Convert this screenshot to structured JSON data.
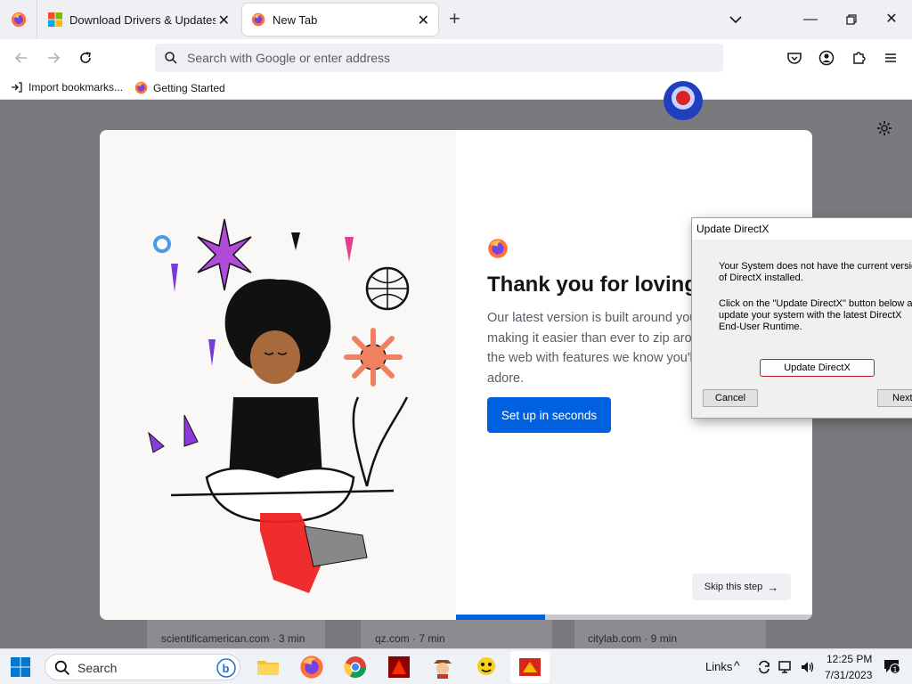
{
  "browser": {
    "tabs": [
      {
        "title": "Download Drivers & Updates for",
        "active": false
      },
      {
        "title": "New Tab",
        "active": true
      }
    ],
    "url_placeholder": "Search with Google or enter address",
    "bookmarks": [
      {
        "label": "Import bookmarks..."
      },
      {
        "label": "Getting Started"
      }
    ]
  },
  "onboarding": {
    "heading": "Thank you for loving Firefox",
    "body": "Our latest version is built around you, making it easier than ever to zip around the web with features we know you'll adore.",
    "primary_button": "Set up in seconds",
    "skip_button": "Skip this step",
    "progress": 0.25
  },
  "top_sites": [
    {
      "label": "scientificamerican.com · 3 min"
    },
    {
      "label": "qz.com · 7 min"
    },
    {
      "label": "citylab.com · 9 min"
    }
  ],
  "dialog": {
    "title": "Update DirectX",
    "text1": "Your System does not have the current version of DirectX installed.",
    "text2": "Click on the \"Update DirectX\" button below and update your system with the latest DirectX End-User Runtime.",
    "update_button": "Update DirectX",
    "cancel_button": "Cancel",
    "next_button": "Next"
  },
  "taskbar": {
    "search_label": "Search",
    "links_label": "Links",
    "time": "12:25 PM",
    "date": "7/31/2023",
    "notification_count": "1"
  },
  "colors": {
    "accent": "#0061e0",
    "dialog_border_red": "#c01c28",
    "windows_blue": "#0078d4"
  }
}
